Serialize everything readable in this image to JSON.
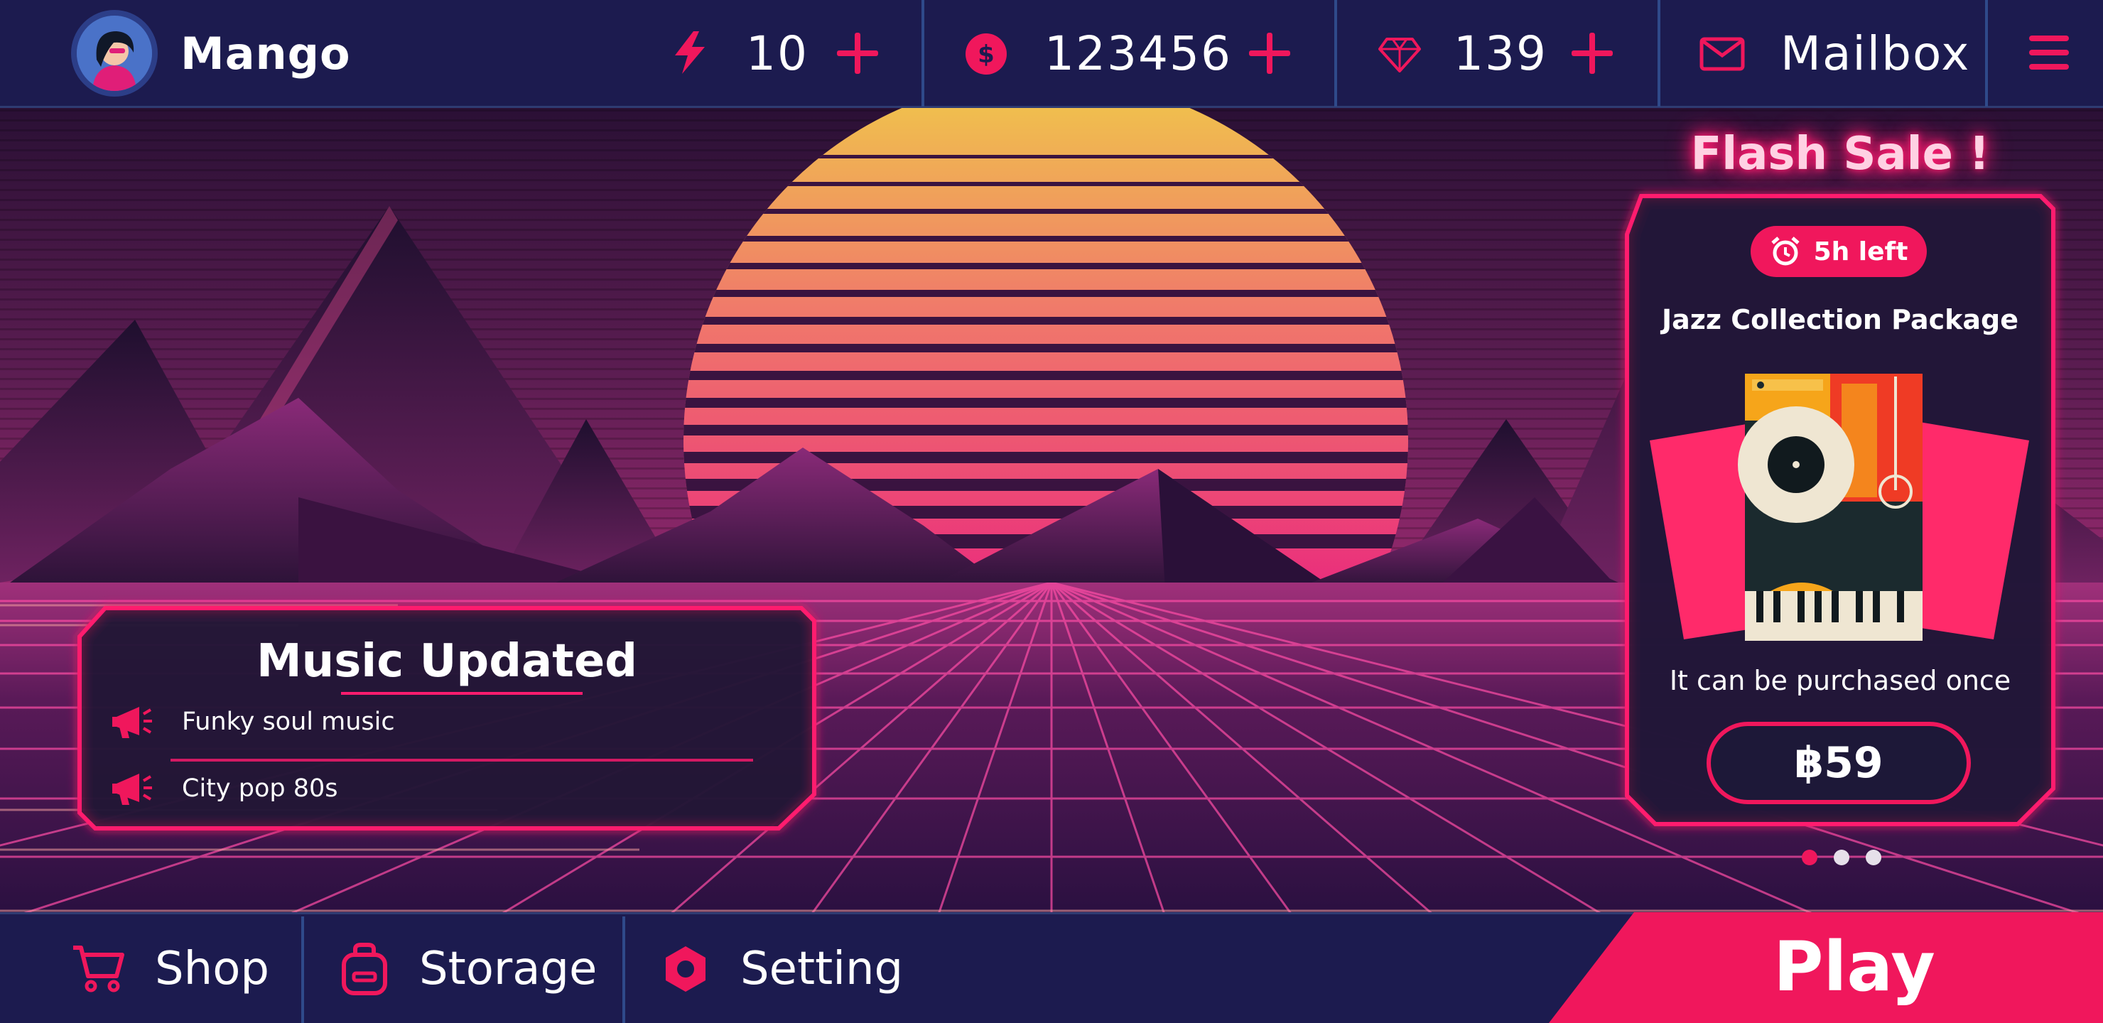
{
  "player": {
    "name": "Mango"
  },
  "resources": {
    "energy": {
      "icon": "lightning-icon",
      "value": "10"
    },
    "coins": {
      "icon": "dollar-coin-icon",
      "value": "123456"
    },
    "gems": {
      "icon": "diamond-icon",
      "value": "139"
    }
  },
  "mailbox": {
    "icon": "mail-icon",
    "label": "Mailbox"
  },
  "music_update": {
    "title": "Music Updated",
    "items": [
      {
        "icon": "megaphone-icon",
        "text": "Funky soul music"
      },
      {
        "icon": "megaphone-icon",
        "text": "City pop 80s"
      }
    ]
  },
  "flash_sale": {
    "title": "Flash Sale !",
    "timer": "5h left",
    "package_name": "Jazz Collection Package",
    "note": "It can be purchased once",
    "price": "฿59",
    "pagination": {
      "total": 3,
      "active": 1
    }
  },
  "bottom_nav": {
    "shop": "Shop",
    "storage": "Storage",
    "setting": "Setting",
    "play": "Play"
  },
  "colors": {
    "accent": "#f0175c",
    "bar_bg": "#1c1b4f",
    "sky_top": "#2a1035",
    "sky_mid": "#8a2d6a",
    "sun_top": "#f0c84a",
    "sun_bottom": "#ea2d7c"
  }
}
